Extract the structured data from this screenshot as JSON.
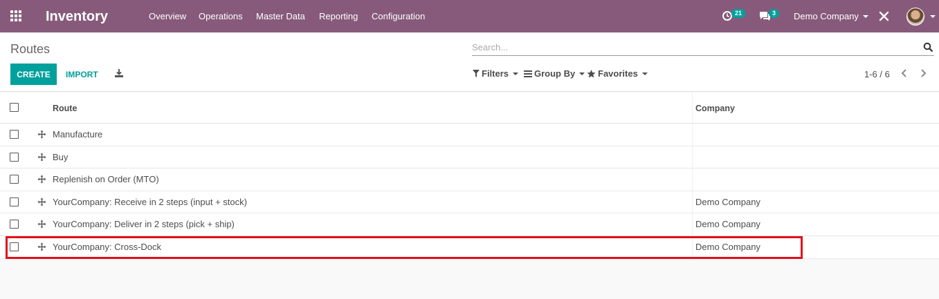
{
  "navbar": {
    "app_title": "Inventory",
    "menu": [
      "Overview",
      "Operations",
      "Master Data",
      "Reporting",
      "Configuration"
    ],
    "activity_count": "21",
    "message_count": "3",
    "company": "Demo Company"
  },
  "control_panel": {
    "breadcrumb": "Routes",
    "search_placeholder": "Search...",
    "create_label": "CREATE",
    "import_label": "IMPORT",
    "filters_label": "Filters",
    "groupby_label": "Group By",
    "favorites_label": "Favorites",
    "pager": "1-6 / 6"
  },
  "table": {
    "columns": [
      "Route",
      "Company"
    ],
    "rows": [
      {
        "route": "Manufacture",
        "company": ""
      },
      {
        "route": "Buy",
        "company": ""
      },
      {
        "route": "Replenish on Order (MTO)",
        "company": ""
      },
      {
        "route": "YourCompany: Receive in 2 steps (input + stock)",
        "company": "Demo Company"
      },
      {
        "route": "YourCompany: Deliver in 2 steps (pick + ship)",
        "company": "Demo Company"
      },
      {
        "route": "YourCompany: Cross-Dock",
        "company": "Demo Company"
      }
    ]
  },
  "colors": {
    "navbar": "#875a7b",
    "primary": "#00a09d",
    "highlight": "#e0101a"
  }
}
